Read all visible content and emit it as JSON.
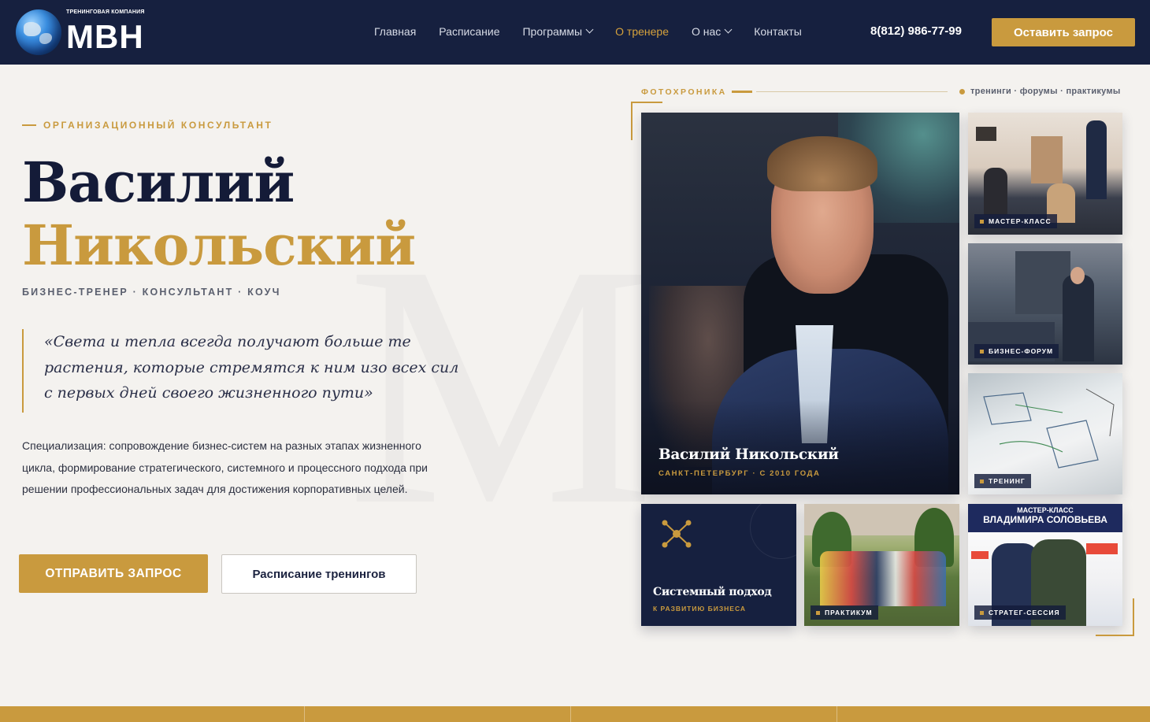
{
  "header": {
    "logo_subtitle": "ТРЕНИНГОВАЯ КОМПАНИЯ",
    "logo_text": "МВН",
    "nav": [
      {
        "label": "Главная"
      },
      {
        "label": "Расписание"
      },
      {
        "label": "Программы"
      },
      {
        "label": "О тренере"
      },
      {
        "label": "О нас"
      },
      {
        "label": "Контакты"
      }
    ],
    "phone": "8(812) 986-77-99",
    "cta_label": "Оставить запрос"
  },
  "hero": {
    "eyebrow": "ОРГАНИЗАЦИОННЫЙ КОНСУЛЬТАНТ",
    "first_name": "Василий",
    "last_name": "Никольский",
    "roles": "БИЗНЕС-ТРЕНЕР · КОНСУЛЬТАНТ · КОУЧ",
    "quote": "«Света и тепла всегда получают больше те растения, которые стремятся к ним изо всех сил с первых дней своего жизненного пути»",
    "specialization": "Специализация: сопровождение бизнес-систем на разных этапах жизненного цикла, формирование стратегического, системного и процессного подхода при решении профессиональных задач для достижения корпоративных целей.",
    "btn_primary": "ОТПРАВИТЬ ЗАПРОС",
    "btn_secondary": "Расписание тренингов",
    "watermark": "M"
  },
  "gallery": {
    "label": "ФОТОХРОНИКА",
    "tags": "тренинги · форумы · практикумы",
    "portrait_name": "Василий Никольский",
    "portrait_sub": "САНКТ-ПЕТЕРБУРГ · С 2010 ГОДА",
    "tiles": [
      {
        "caption": "МАСТЕР-КЛАСС"
      },
      {
        "caption": "БИЗНЕС-ФОРУМ"
      },
      {
        "caption": "ТРЕНИНГ"
      },
      {
        "caption": "ПРАКТИКУМ"
      },
      {
        "caption": "СТРАТЕГ-СЕССИЯ"
      }
    ],
    "feature_tile": {
      "title": "Системный подход",
      "subtitle": "К РАЗВИТИЮ БИЗНЕСА"
    },
    "poster": {
      "line1": "МАСТЕР-КЛАСС",
      "line2": "ВЛАДИМИРА СОЛОВЬЕВА"
    }
  },
  "colors": {
    "navy": "#16203f",
    "gold": "#c99a3e",
    "background": "#f4f2ef"
  }
}
